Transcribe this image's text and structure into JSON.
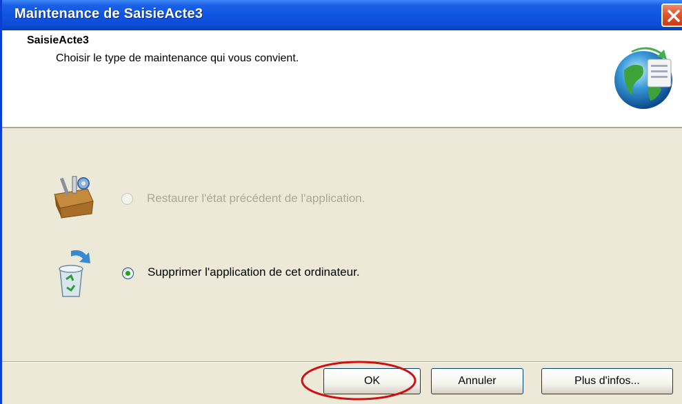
{
  "window": {
    "title": "Maintenance de SaisieActe3"
  },
  "header": {
    "app_name": "SaisieActe3",
    "subtitle": "Choisir le type de maintenance qui vous convient.",
    "icon": "globe-setup-icon"
  },
  "options": [
    {
      "label": "Restaurer l'état précédent de l'application.",
      "enabled": false,
      "selected": false,
      "icon": "toolbox-icon"
    },
    {
      "label": "Supprimer l'application de cet ordinateur.",
      "enabled": true,
      "selected": true,
      "icon": "recycle-bin-icon"
    }
  ],
  "buttons": {
    "ok": "OK",
    "cancel": "Annuler",
    "more_info": "Plus d'infos..."
  },
  "colors": {
    "titlebar": "#0c4bd4",
    "dialog_bg": "#ece9d8",
    "highlight_ellipse": "#d01010"
  }
}
